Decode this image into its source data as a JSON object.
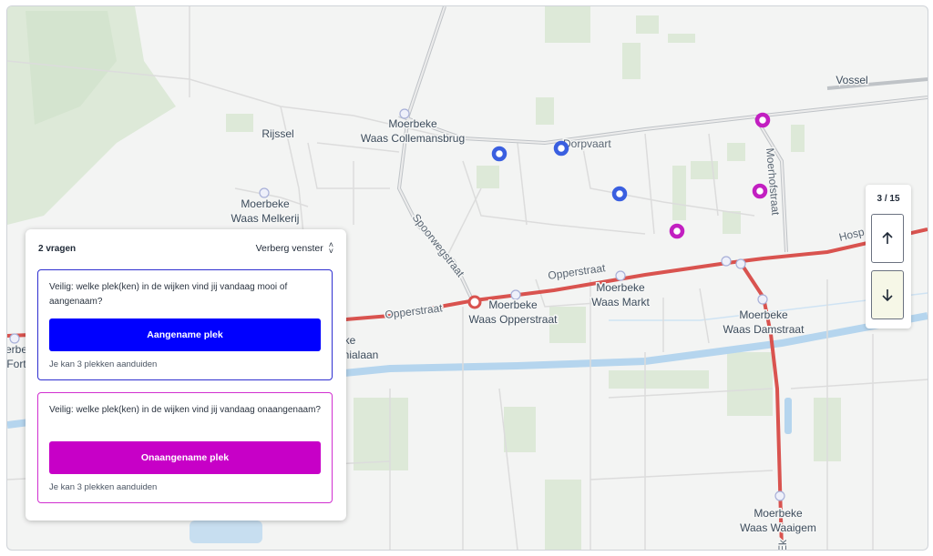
{
  "map": {
    "places": [
      {
        "line1": "Moerbeke",
        "line2": "Waas Collemansbrug"
      },
      {
        "line1": "Rijssel",
        "line2": ""
      },
      {
        "line1": "Moerbeke",
        "line2": "Waas Melkerij"
      },
      {
        "line1": "Moerbeke",
        "line2": "Waas Opperstraat"
      },
      {
        "line1": "Moerbeke",
        "line2": "Waas Markt"
      },
      {
        "line1": "Moerbeke",
        "line2": "Waas Damstraat"
      },
      {
        "line1": "Moerbeke",
        "line2": "Waas Waaigem"
      },
      {
        "line1": "Vossel",
        "line2": ""
      }
    ],
    "roads": {
      "dorpvaart": "Dorpvaart",
      "spoorwegstraat": "Spoorwegstraat",
      "opperstraat_1": "Opperstraat",
      "opperstraat_2": "Opperstraat",
      "moerhofstraat": "Moerhofstraat",
      "hosp": "Hosp",
      "ek": "Ek"
    },
    "edge_fragments": {
      "left_1": "erbe",
      "left_2": "Fort",
      "under_panel_1": "ke",
      "under_panel_2": "nialaan"
    },
    "colors": {
      "pleasant_marker": "#3a5fe0",
      "unpleasant_marker": "#c21fc1",
      "main_road": "#d9534f"
    }
  },
  "panel": {
    "count_label": "2 vragen",
    "hide_label": "Verberg venster",
    "questions": [
      {
        "text": "Veilig: welke plek(ken) in de wijken vind jij vandaag mooi of aangenaam?",
        "button": "Aangename plek",
        "hint": "Je kan 3 plekken aanduiden",
        "color": "#0000ff"
      },
      {
        "text": "Veilig: welke plek(ken) in de wijken vind jij vandaag onaangenaam?",
        "button": "Onaangename plek",
        "hint": "Je kan 3 plekken aanduiden",
        "color": "#c700c7"
      }
    ]
  },
  "pager": {
    "current": 3,
    "total": 15,
    "label": "3 / 15"
  }
}
